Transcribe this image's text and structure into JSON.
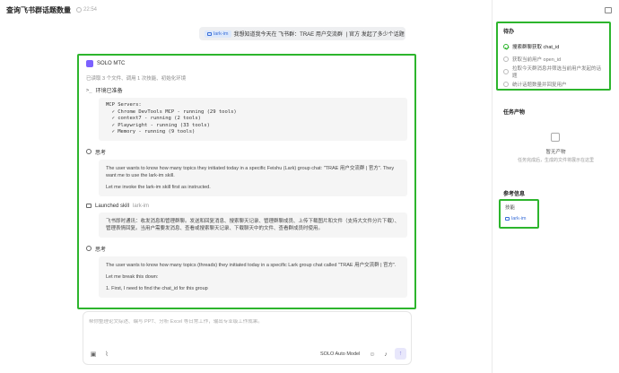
{
  "header": {
    "title": "查询飞书群话题数量",
    "time": "22:54"
  },
  "user_message": {
    "tag": "lark-im",
    "text": "我想知道我今天在 飞书群：TRAE 用户交流群",
    "text_suffix": "| 官方 发起了多少个话题"
  },
  "response": {
    "agent_name": "SOLO MTC",
    "status": "已读取 3 个文件、调用 1 次技能、初始化环境",
    "env_section": {
      "title": "环境已准备",
      "code": "MCP Servers:\n  ✓ Chrome DevTools MCP - running (29 tools)\n  ✓ context7 - running (2 tools)\n  ✓ Playwright - running (33 tools)\n  ✓ Memory - running (9 tools)"
    },
    "think1": {
      "title": "思考",
      "lines": [
        "The user wants to know how many topics they initiated today in a specific Feishu (Lark) group chat: \"TRAE 用户交流群 | 官方\". They want me to use the lark-im skill.",
        "Let me invoke the lark-im skill first as instructed."
      ]
    },
    "skill": {
      "title": "Launched skill",
      "name": "lark-im",
      "desc": "飞书即时通讯：收发消息和管理群聊。发送和回复消息、搜索聊天记录、管理群聊成员、上传下载图片和文件（支持大文件分片下载）、管理表情回复。当用户需要发消息、查看或搜索聊天记录、下载聊天中的文件、查看群成员时使用。"
    },
    "think2": {
      "title": "思考",
      "lines": [
        "The user wants to know how many topics (threads) they initiated today in a specific Lark group chat called \"TRAE 用户交流群 | 官方\".",
        "Let me break this down:",
        "1. First, I need to find the chat_id for this group"
      ]
    }
  },
  "composer": {
    "placeholder": "帮你整理论文综述、编写 PPT、分析 Excel 等日常工作，输出专业级工作成果。",
    "model": "SOLO Auto Model"
  },
  "sidebar": {
    "todo": {
      "title": "待办",
      "items": [
        {
          "label": "搜索群聊获取 chat_id",
          "done": true
        },
        {
          "label": "获取当前用户 open_id",
          "done": false
        },
        {
          "label": "拉取今天群消息并筛选当前用户发起的话题",
          "done": false
        },
        {
          "label": "统计话题数量并回复用户",
          "done": false
        }
      ]
    },
    "output": {
      "title": "任务产物",
      "empty_title": "暂无产物",
      "empty_sub": "任务完成后，生成的文件将展示在这里"
    },
    "reference": {
      "title": "参考信息",
      "label": "技能",
      "skill": "lark-im"
    }
  },
  "colors": {
    "highlight": "#2db52d",
    "accent": "#3a6fd8",
    "agent": "#7b61ff"
  }
}
